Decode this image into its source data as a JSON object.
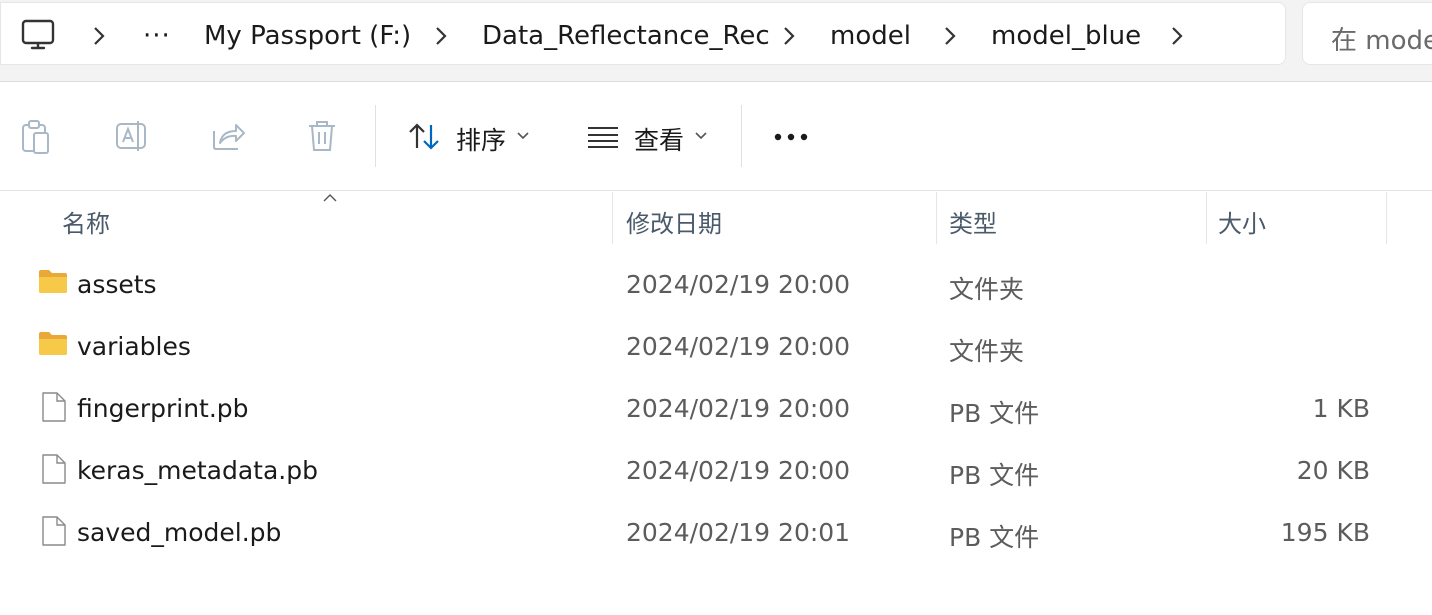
{
  "address_bar": {
    "more_glyph": "···",
    "crumbs": [
      "My Passport (F:)",
      "Data_Reflectance_Rec",
      "model",
      "model_blue"
    ]
  },
  "search": {
    "placeholder": "在 model_blue 中搜索"
  },
  "toolbar": {
    "sort_label": "排序",
    "view_label": "查看"
  },
  "columns": {
    "name": "名称",
    "modified": "修改日期",
    "type": "类型",
    "size": "大小"
  },
  "files": [
    {
      "name": "assets",
      "modified": "2024/02/19 20:00",
      "type": "文件夹",
      "size": "",
      "icon": "folder-icon"
    },
    {
      "name": "variables",
      "modified": "2024/02/19 20:00",
      "type": "文件夹",
      "size": "",
      "icon": "folder-icon"
    },
    {
      "name": "fingerprint.pb",
      "modified": "2024/02/19 20:00",
      "type": "PB 文件",
      "size": "1 KB",
      "icon": "file-icon"
    },
    {
      "name": "keras_metadata.pb",
      "modified": "2024/02/19 20:00",
      "type": "PB 文件",
      "size": "20 KB",
      "icon": "file-icon"
    },
    {
      "name": "saved_model.pb",
      "modified": "2024/02/19 20:01",
      "type": "PB 文件",
      "size": "195 KB",
      "icon": "file-icon"
    }
  ],
  "colors": {
    "folder": "#f7c948",
    "folder_back": "#e8a93a",
    "accent": "#0067c0"
  }
}
